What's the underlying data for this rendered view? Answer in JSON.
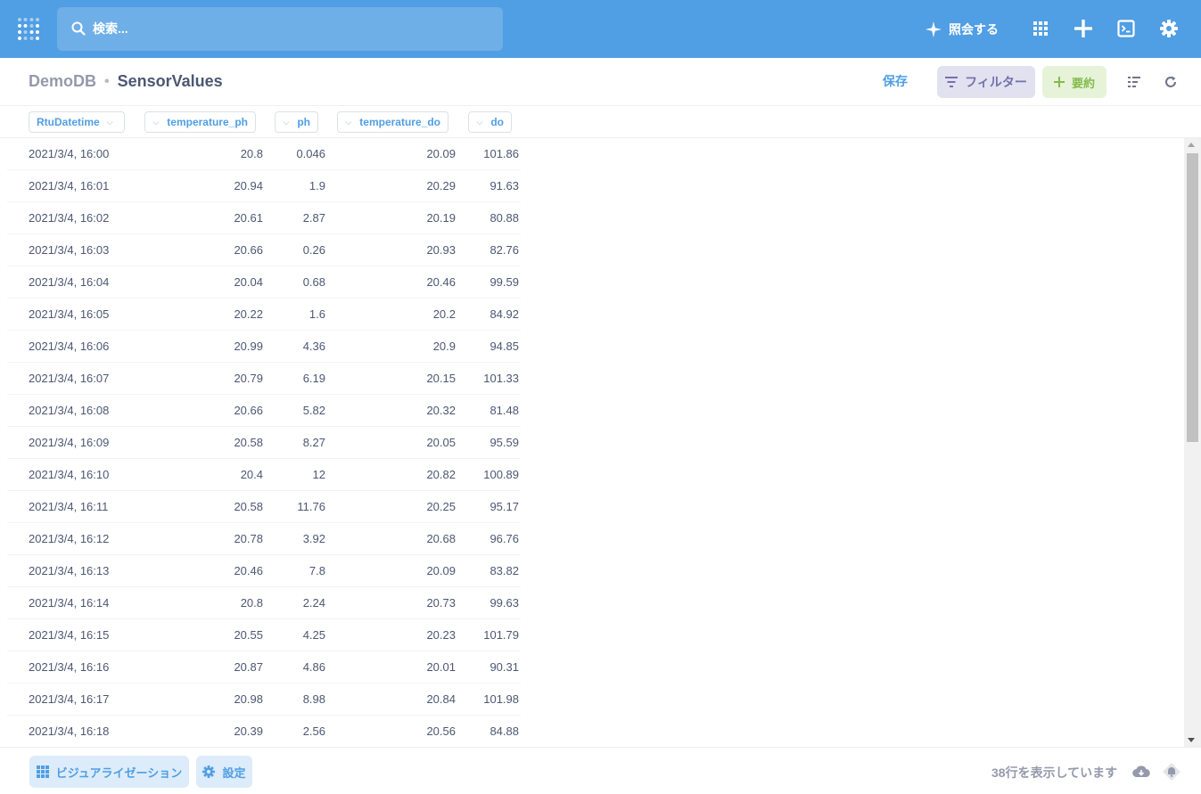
{
  "search": {
    "placeholder": "検索..."
  },
  "topbar": {
    "ask_label": "照会する"
  },
  "breadcrumb": {
    "database": "DemoDB",
    "separator": "•",
    "table": "SensorValues"
  },
  "actions": {
    "save": "保存",
    "filter": "フィルター",
    "summarize": "要約"
  },
  "columns": [
    "RtuDatetime",
    "temperature_ph",
    "ph",
    "temperature_do",
    "do"
  ],
  "rows": [
    [
      "2021/3/4, 16:00",
      "20.8",
      "0.046",
      "20.09",
      "101.86"
    ],
    [
      "2021/3/4, 16:01",
      "20.94",
      "1.9",
      "20.29",
      "91.63"
    ],
    [
      "2021/3/4, 16:02",
      "20.61",
      "2.87",
      "20.19",
      "80.88"
    ],
    [
      "2021/3/4, 16:03",
      "20.66",
      "0.26",
      "20.93",
      "82.76"
    ],
    [
      "2021/3/4, 16:04",
      "20.04",
      "0.68",
      "20.46",
      "99.59"
    ],
    [
      "2021/3/4, 16:05",
      "20.22",
      "1.6",
      "20.2",
      "84.92"
    ],
    [
      "2021/3/4, 16:06",
      "20.99",
      "4.36",
      "20.9",
      "94.85"
    ],
    [
      "2021/3/4, 16:07",
      "20.79",
      "6.19",
      "20.15",
      "101.33"
    ],
    [
      "2021/3/4, 16:08",
      "20.66",
      "5.82",
      "20.32",
      "81.48"
    ],
    [
      "2021/3/4, 16:09",
      "20.58",
      "8.27",
      "20.05",
      "95.59"
    ],
    [
      "2021/3/4, 16:10",
      "20.4",
      "12",
      "20.82",
      "100.89"
    ],
    [
      "2021/3/4, 16:11",
      "20.58",
      "11.76",
      "20.25",
      "95.17"
    ],
    [
      "2021/3/4, 16:12",
      "20.78",
      "3.92",
      "20.68",
      "96.76"
    ],
    [
      "2021/3/4, 16:13",
      "20.46",
      "7.8",
      "20.09",
      "83.82"
    ],
    [
      "2021/3/4, 16:14",
      "20.8",
      "2.24",
      "20.73",
      "99.63"
    ],
    [
      "2021/3/4, 16:15",
      "20.55",
      "4.25",
      "20.23",
      "101.79"
    ],
    [
      "2021/3/4, 16:16",
      "20.87",
      "4.86",
      "20.01",
      "90.31"
    ],
    [
      "2021/3/4, 16:17",
      "20.98",
      "8.98",
      "20.84",
      "101.98"
    ],
    [
      "2021/3/4, 16:18",
      "20.39",
      "2.56",
      "20.56",
      "84.88"
    ]
  ],
  "footer": {
    "visualization": "ビジュアライゼーション",
    "settings": "設定",
    "row_count": "38行を表示しています"
  },
  "colors": {
    "brand": "#509ee3",
    "filter": "#7172ad",
    "summarize": "#84bb4c",
    "text": "#4c5773"
  },
  "icons": [
    "metabase-logo-icon",
    "search-icon",
    "sparkle-icon",
    "apps-grid-icon",
    "plus-icon",
    "sql-editor-icon",
    "gear-icon",
    "filter-icon",
    "summarize-plus-icon",
    "list-icon",
    "refresh-icon",
    "chevron-down-icon",
    "table-grid-icon",
    "download-icon",
    "alert-bell-icon"
  ]
}
